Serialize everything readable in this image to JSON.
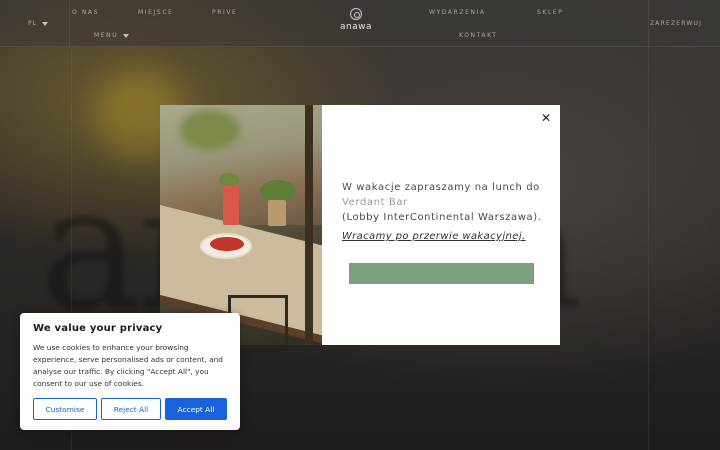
{
  "header": {
    "language": "PL",
    "nav_left_top": [
      "O NAS",
      "MIEJSCE",
      "PRIVE"
    ],
    "menu_label": "MENU",
    "logo_text": "anawa",
    "nav_right_top": [
      "WYDARZENIA",
      "SKLEP"
    ],
    "contact_label": "KONTAKT",
    "reserve_label": "ZAREZERWUJ"
  },
  "modal": {
    "close_icon": "✕",
    "line1": "W wakacje zapraszamy na lunch do",
    "verdant": "Verdant Bar",
    "line3": "(Lobby InterContinental Warszawa).",
    "back_text": "Wracamy po przerwie wakacyjnej.",
    "button_color": "#7e9f7e"
  },
  "cookie": {
    "title": "We value your privacy",
    "text": "We use cookies to enhance your browsing experience, serve personalised ads or content, and analyse our traffic. By clicking \"Accept All\", you consent to our use of cookies.",
    "customise": "Customise",
    "reject": "Reject All",
    "accept": "Accept All",
    "accent_color": "#1863dc"
  }
}
